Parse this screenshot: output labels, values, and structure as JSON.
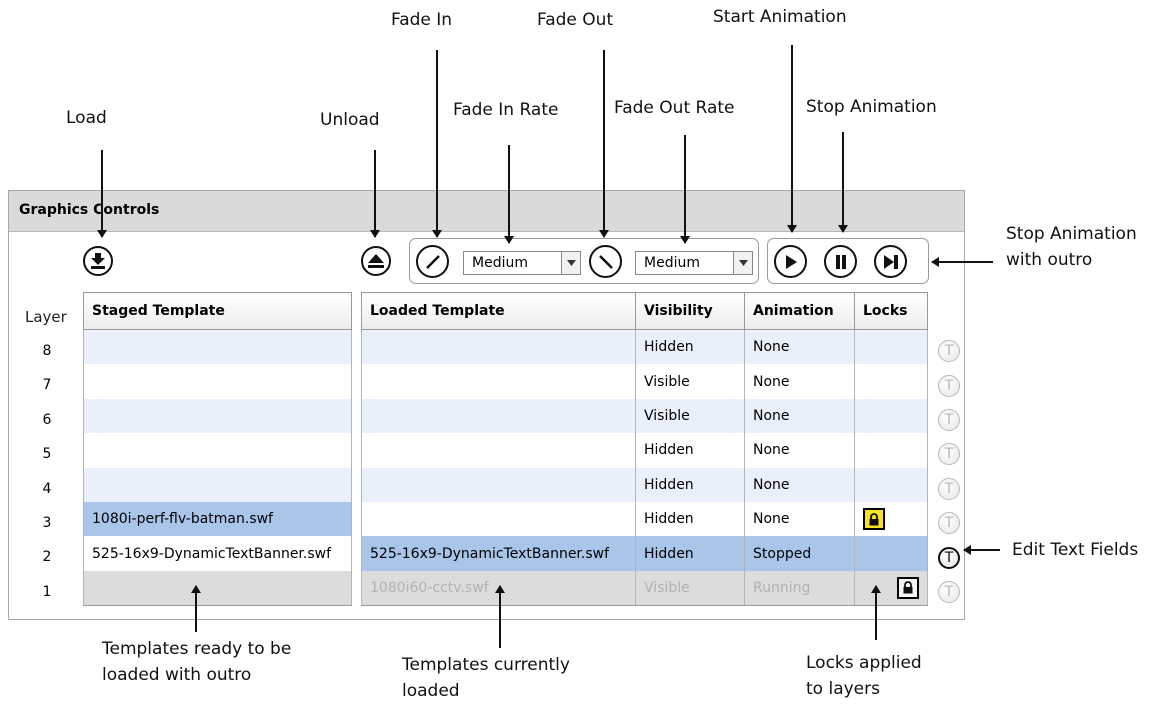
{
  "callouts": {
    "load": "Load",
    "unload": "Unload",
    "fade_in": "Fade In",
    "fade_in_rate": "Fade In Rate",
    "fade_out": "Fade Out",
    "fade_out_rate": "Fade Out Rate",
    "start_animation": "Start Animation",
    "stop_animation": "Stop Animation",
    "stop_with_outro_1": "Stop Animation",
    "stop_with_outro_2": "with outro",
    "edit_text_fields": "Edit Text Fields",
    "templates_ready_1": "Templates ready to be",
    "templates_ready_2": "loaded with outro",
    "templates_loaded_1": "Templates currently",
    "templates_loaded_2": "loaded",
    "locks_1": "Locks applied",
    "locks_2": "to layers"
  },
  "panel": {
    "title": "Graphics Controls",
    "fade_in_rate": {
      "selected": "Medium"
    },
    "fade_out_rate": {
      "selected": "Medium"
    },
    "layer_header": "Layer",
    "staged_header": "Staged Template",
    "loaded_headers": {
      "loaded": "Loaded Template",
      "visibility": "Visibility",
      "animation": "Animation",
      "locks": "Locks"
    },
    "layers": [
      {
        "layer": "8",
        "staged": "",
        "loaded": "",
        "visibility": "Hidden",
        "animation": "None",
        "lock": "none"
      },
      {
        "layer": "7",
        "staged": "",
        "loaded": "",
        "visibility": "Visible",
        "animation": "None",
        "lock": "none"
      },
      {
        "layer": "6",
        "staged": "",
        "loaded": "",
        "visibility": "Visible",
        "animation": "None",
        "lock": "none"
      },
      {
        "layer": "5",
        "staged": "",
        "loaded": "",
        "visibility": "Hidden",
        "animation": "None",
        "lock": "none"
      },
      {
        "layer": "4",
        "staged": "",
        "loaded": "",
        "visibility": "Hidden",
        "animation": "None",
        "lock": "none"
      },
      {
        "layer": "3",
        "staged": "1080i-perf-flv-batman.swf",
        "loaded": "",
        "visibility": "Hidden",
        "animation": "None",
        "lock": "yellow"
      },
      {
        "layer": "2",
        "staged": "525-16x9-DynamicTextBanner.swf",
        "loaded": "525-16x9-DynamicTextBanner.swf",
        "visibility": "Hidden",
        "animation": "Stopped",
        "lock": "none"
      },
      {
        "layer": "1",
        "staged": "",
        "loaded": "1080i60-cctv.swf",
        "visibility": "Visible",
        "animation": "Running",
        "lock": "gray"
      }
    ],
    "text_button_glyph": "T",
    "colors": {
      "selected_row": "#a9c6ea",
      "alt_row": "#eaf0fb",
      "lock_yellow": "#f5e02a",
      "header_bar": "#dadada"
    }
  }
}
